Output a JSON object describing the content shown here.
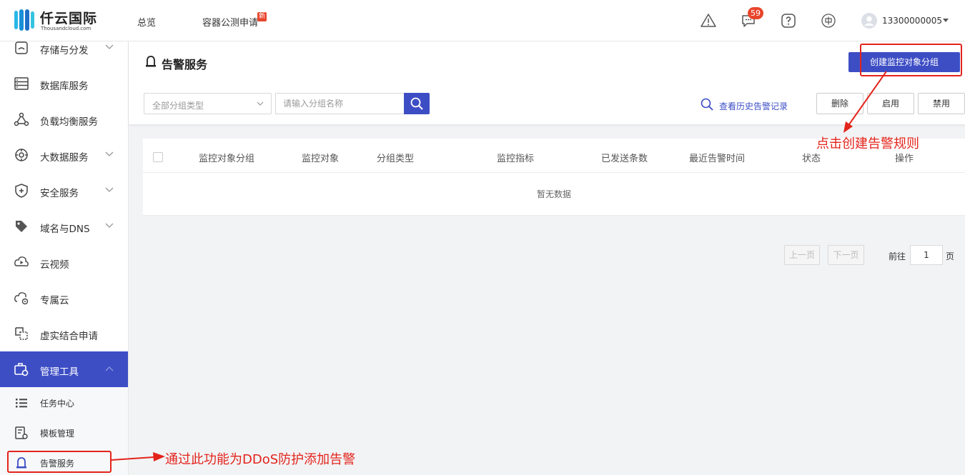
{
  "header": {
    "logo_text": "仟云国际",
    "logo_sub": "Thousandcloud.com",
    "nav": [
      {
        "label": "总览"
      },
      {
        "label": "容器公测申请",
        "badge": "新"
      }
    ],
    "message_count": "59",
    "lang_icon_label": "中",
    "user_name": "13300000005"
  },
  "sidebar": {
    "items": [
      {
        "label": "存储与分发",
        "icon": "storage-icon",
        "expandable": true
      },
      {
        "label": "数据库服务",
        "icon": "database-icon",
        "expandable": false
      },
      {
        "label": "负载均衡服务",
        "icon": "load-balancer-icon",
        "expandable": false
      },
      {
        "label": "大数据服务",
        "icon": "big-data-icon",
        "expandable": true
      },
      {
        "label": "安全服务",
        "icon": "shield-icon",
        "expandable": true
      },
      {
        "label": "域名与DNS",
        "icon": "domain-tag-icon",
        "expandable": true
      },
      {
        "label": "云视频",
        "icon": "video-icon",
        "expandable": false
      },
      {
        "label": "专属云",
        "icon": "private-cloud-icon",
        "expandable": false
      },
      {
        "label": "虚实结合申请",
        "icon": "hybrid-apply-icon",
        "expandable": false
      },
      {
        "label": "管理工具",
        "icon": "tools-icon",
        "expandable": true,
        "active": true
      }
    ],
    "sub_items": [
      {
        "label": "任务中心",
        "icon": "list-icon"
      },
      {
        "label": "模板管理",
        "icon": "template-icon"
      },
      {
        "label": "告警服务",
        "icon": "alarm-icon"
      }
    ]
  },
  "page": {
    "title": "告警服务",
    "create_button": "创建监控对象分组",
    "filter_select": "全部分组类型",
    "search_placeholder": "请输入分组名称",
    "history_link": "查看历史告警记录",
    "buttons": {
      "delete": "删除",
      "enable": "启用",
      "disable": "禁用"
    }
  },
  "table": {
    "columns": [
      "监控对象分组",
      "监控对象",
      "分组类型",
      "监控指标",
      "已发送条数",
      "最近告警时间",
      "状态",
      "操作"
    ],
    "empty_text": "暂无数据"
  },
  "pagination": {
    "prev": "上一页",
    "next": "下一页",
    "goto_label": "前往",
    "page": "1",
    "page_suffix": "页"
  },
  "annotations": {
    "create_hint": "点击创建告警规则",
    "ddos_hint": "通过此功能为DDoS防护添加告警",
    "color": "#e3241b"
  },
  "colors": {
    "accent": "#3d4ec5",
    "badge": "#e8452c"
  }
}
